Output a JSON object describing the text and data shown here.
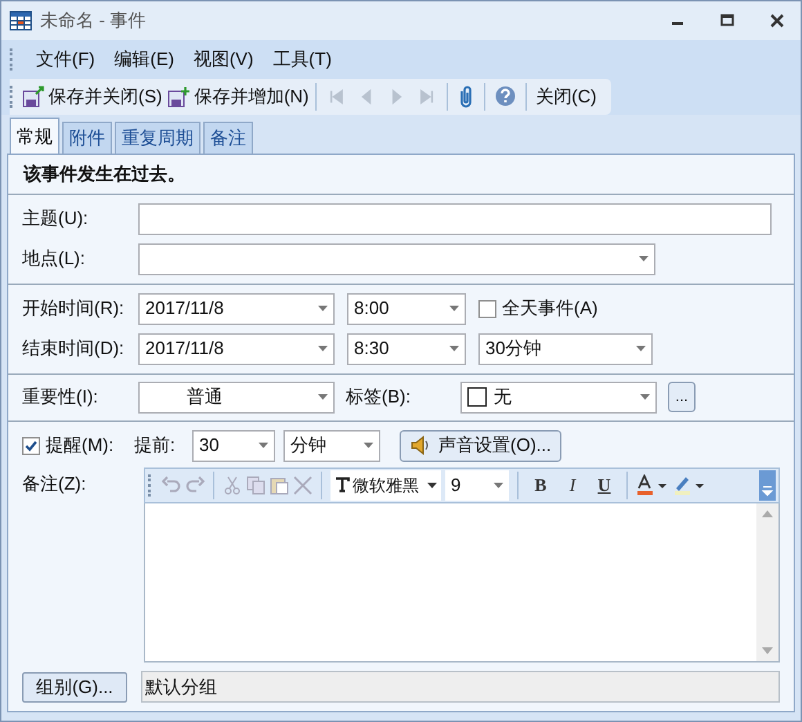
{
  "window": {
    "title": "未命名 - 事件"
  },
  "menu": [
    "文件(F)",
    "编辑(E)",
    "视图(V)",
    "工具(T)"
  ],
  "toolbar": {
    "save_buttons": [
      {
        "label": "保存并关闭(S)"
      },
      {
        "label": "保存并增加(N)"
      }
    ],
    "nav_buttons": [
      {
        "disabled": true
      },
      {
        "disabled": true
      },
      {
        "disabled": true
      },
      {
        "disabled": true
      }
    ],
    "close_button": "关闭(C)"
  },
  "tabs": [
    {
      "label": "常规",
      "selected": true
    },
    {
      "label": "附件",
      "selected": false
    },
    {
      "label": "重复周期",
      "selected": false
    },
    {
      "label": "备注",
      "selected": false
    }
  ],
  "notice": "该事件发生在过去。",
  "subject": {
    "label": "主题(U):"
  },
  "location": {
    "label": "地点(L):"
  },
  "start": {
    "label": "开始时间(R):",
    "date": "2017/11/8",
    "time": "8:00"
  },
  "all_day": {
    "label": "全天事件(A)",
    "checked": false
  },
  "end": {
    "label": "结束时间(D):",
    "date": "2017/11/8",
    "time": "8:30",
    "duration": "30分钟"
  },
  "importance": {
    "label": "重要性(I):",
    "value": "普通"
  },
  "tag": {
    "label": "标签(B):",
    "value": "无",
    "more_button": "..."
  },
  "reminder": {
    "label": "提醒(M):",
    "checked": true,
    "advance_label": "提前:",
    "amount": "30",
    "unit": "分钟",
    "sound_button": "声音设置(O)..."
  },
  "notes": {
    "label": "备注(Z):",
    "font": "微软雅黑",
    "size": "9",
    "format_buttons": [
      {
        "label": "B",
        "kind": "bold"
      },
      {
        "label": "I",
        "kind": "italic"
      },
      {
        "label": "U",
        "kind": "underline"
      }
    ]
  },
  "group": {
    "button": "组别(G)...",
    "value": "默认分组"
  }
}
